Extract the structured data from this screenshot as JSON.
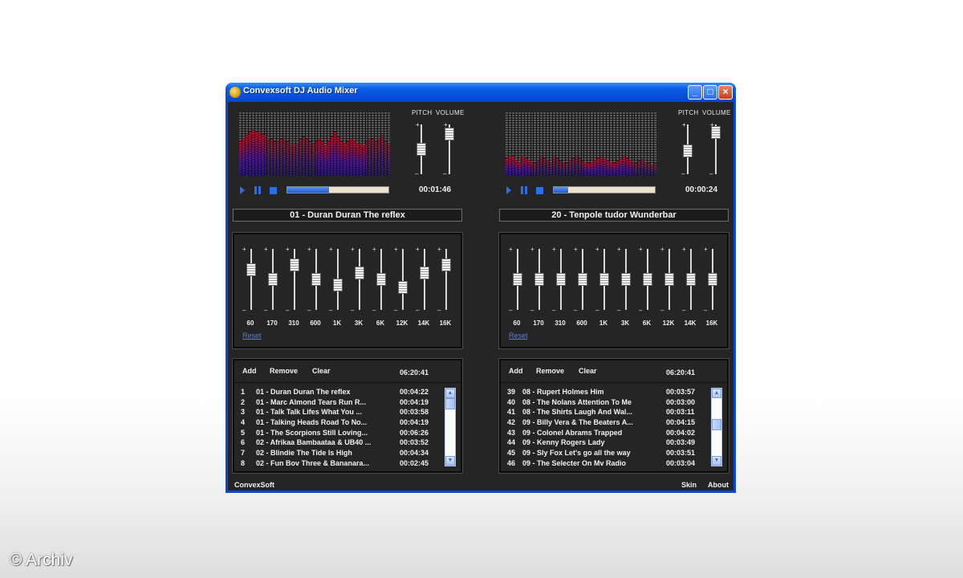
{
  "window": {
    "title": "Convexsoft DJ Audio Mixer",
    "min_icon": "minimize-icon",
    "max_icon": "maximize-icon",
    "close_icon": "close-icon"
  },
  "labels": {
    "pitch": "PITCH",
    "volume": "VOLUME",
    "plus": "+",
    "minus": "–"
  },
  "decks": [
    {
      "time": "00:01:46",
      "progress": 0.41,
      "now_playing": "01 - Duran Duran   The reflex",
      "pitch_level": 0.5,
      "volume_level": 0.92,
      "spectrum": [
        0.55,
        0.6,
        0.65,
        0.7,
        0.72,
        0.7,
        0.68,
        0.66,
        0.65,
        0.6,
        0.58,
        0.55,
        0.56,
        0.58,
        0.6,
        0.55,
        0.5,
        0.5,
        0.52,
        0.58,
        0.62,
        0.58,
        0.55,
        0.5,
        0.55,
        0.6,
        0.55,
        0.48,
        0.55,
        0.62,
        0.7,
        0.62,
        0.55,
        0.5,
        0.55,
        0.6,
        0.56,
        0.52,
        0.5,
        0.48,
        0.55,
        0.6,
        0.58,
        0.55,
        0.6,
        0.65,
        0.55,
        0.5
      ],
      "eq": {
        "bands": [
          {
            "freq": "60",
            "level": 0.7
          },
          {
            "freq": "170",
            "level": 0.5
          },
          {
            "freq": "310",
            "level": 0.8
          },
          {
            "freq": "600",
            "level": 0.5
          },
          {
            "freq": "1K",
            "level": 0.38
          },
          {
            "freq": "3K",
            "level": 0.63
          },
          {
            "freq": "6K",
            "level": 0.5
          },
          {
            "freq": "12K",
            "level": 0.33
          },
          {
            "freq": "14K",
            "level": 0.63
          },
          {
            "freq": "16K",
            "level": 0.8
          }
        ],
        "reset": "Reset"
      },
      "playlist": {
        "add": "Add",
        "remove": "Remove",
        "clear": "Clear",
        "total": "06:20:41",
        "scroll_pos": 0.0,
        "rows": [
          {
            "num": "1",
            "title": "01 - Duran Duran   The reflex",
            "dur": "00:04:22"
          },
          {
            "num": "2",
            "title": "01 - Marc Almond   Tears Run R...",
            "dur": "00:04:19"
          },
          {
            "num": "3",
            "title": "01 - Talk Talk   Lifes What You ...",
            "dur": "00:03:58"
          },
          {
            "num": "4",
            "title": "01 - Talking Heads   Road To No...",
            "dur": "00:04:19"
          },
          {
            "num": "5",
            "title": "01 - The Scorpions   Still Loving...",
            "dur": "00:06:26"
          },
          {
            "num": "6",
            "title": "02 - Afrikaa Bambaataa & UB40   ...",
            "dur": "00:03:52"
          },
          {
            "num": "7",
            "title": "02 - Blindie   The Tide Is High",
            "dur": "00:04:34"
          },
          {
            "num": "8",
            "title": "02 - Fun Bov Three & Bananara...",
            "dur": "00:02:45"
          }
        ]
      }
    },
    {
      "time": "00:00:24",
      "progress": 0.14,
      "now_playing": "20 - Tenpole tudor   Wunderbar",
      "pitch_level": 0.45,
      "volume_level": 0.95,
      "spectrum": [
        0.28,
        0.3,
        0.32,
        0.25,
        0.22,
        0.3,
        0.28,
        0.25,
        0.22,
        0.2,
        0.25,
        0.3,
        0.28,
        0.25,
        0.22,
        0.3,
        0.28,
        0.24,
        0.22,
        0.2,
        0.25,
        0.28,
        0.3,
        0.28,
        0.24,
        0.22,
        0.2,
        0.22,
        0.25,
        0.28,
        0.3,
        0.27,
        0.24,
        0.22,
        0.2,
        0.24,
        0.27,
        0.3,
        0.28,
        0.25,
        0.22,
        0.2,
        0.24,
        0.26,
        0.22,
        0.2,
        0.18,
        0.2
      ],
      "eq": {
        "bands": [
          {
            "freq": "60",
            "level": 0.5
          },
          {
            "freq": "170",
            "level": 0.5
          },
          {
            "freq": "310",
            "level": 0.5
          },
          {
            "freq": "600",
            "level": 0.5
          },
          {
            "freq": "1K",
            "level": 0.5
          },
          {
            "freq": "3K",
            "level": 0.5
          },
          {
            "freq": "6K",
            "level": 0.5
          },
          {
            "freq": "12K",
            "level": 0.5
          },
          {
            "freq": "14K",
            "level": 0.5
          },
          {
            "freq": "16K",
            "level": 0.5
          }
        ],
        "reset": "Reset"
      },
      "playlist": {
        "add": "Add",
        "remove": "Remove",
        "clear": "Clear",
        "total": "06:20:41",
        "scroll_pos": 0.45,
        "rows": [
          {
            "num": "39",
            "title": "08 - Rupert Holmes   Him",
            "dur": "00:03:57"
          },
          {
            "num": "40",
            "title": "08 - The Nolans   Attention To Me",
            "dur": "00:03:00"
          },
          {
            "num": "41",
            "title": "08 - The Shirts   Laugh And Wal...",
            "dur": "00:03:11"
          },
          {
            "num": "42",
            "title": "09 - Billy Vera & The Beaters   A...",
            "dur": "00:04:15"
          },
          {
            "num": "43",
            "title": "09 - Colonel Abrams   Trapped",
            "dur": "00:04:02"
          },
          {
            "num": "44",
            "title": "09 - Kenny Rogers   Lady",
            "dur": "00:03:49"
          },
          {
            "num": "45",
            "title": "09 - Sly Fox   Let's go all the way",
            "dur": "00:03:51"
          },
          {
            "num": "46",
            "title": "09 - The Selecter   On Mv Radio",
            "dur": "00:03:04"
          }
        ]
      }
    }
  ],
  "footer": {
    "brand": "ConvexSoft",
    "skin": "Skin",
    "about": "About"
  },
  "watermark": "© Archiv"
}
